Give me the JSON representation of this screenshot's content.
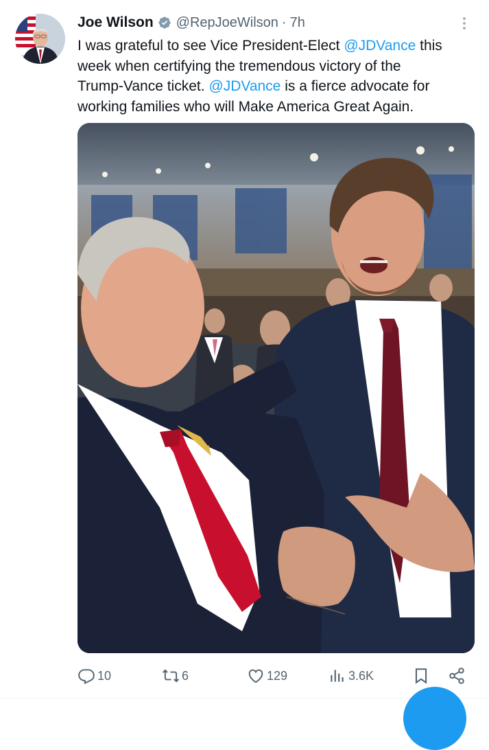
{
  "post": {
    "author_name": "Joe Wilson",
    "handle": "@RepJoeWilson",
    "separator": "·",
    "time": "7h",
    "text_lines": [
      [
        {
          "t": "I was grateful to see Vice President-Elect "
        },
        {
          "t": "@JDVance",
          "m": true
        },
        {
          "t": " this"
        }
      ],
      [
        {
          "t": "week when certifying the tremendous victory of the"
        }
      ],
      [
        {
          "t": "Trump-Vance ticket. "
        },
        {
          "t": "@JDVance",
          "m": true
        },
        {
          "t": " is a fierce advocate for"
        }
      ],
      [
        {
          "t": "working families who will Make America Great Again."
        }
      ]
    ]
  },
  "icons": {
    "verified": "verified-badge-icon",
    "more": "more-options-icon",
    "reply": "reply-icon",
    "repost": "repost-icon",
    "like": "like-icon",
    "views": "views-icon",
    "bookmark": "bookmark-icon",
    "share": "share-icon"
  },
  "actions": {
    "replies": "10",
    "reposts": "6",
    "likes": "129",
    "views": "3.6K"
  },
  "colors": {
    "accent": "#1d9bf0",
    "text": "#0f1419",
    "muted": "#536471",
    "tie_red": "#c8102e",
    "tie_burgundy": "#6e1424",
    "suit_navy": "#1f2a44"
  }
}
